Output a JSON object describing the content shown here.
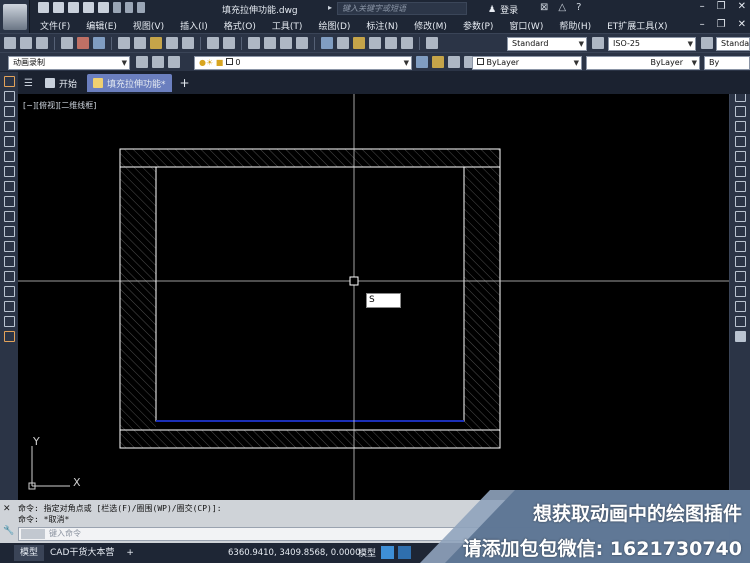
{
  "title_bar": {
    "doc_title": "填充拉伸功能.dwg",
    "search_placeholder": "键入关键字或短语",
    "login_label": "登录"
  },
  "menu": {
    "items": [
      "文件(F)",
      "编辑(E)",
      "视图(V)",
      "插入(I)",
      "格式(O)",
      "工具(T)",
      "绘图(D)",
      "标注(N)",
      "修改(M)",
      "参数(P)",
      "窗口(W)",
      "帮助(H)",
      "ET扩展工具(X)"
    ]
  },
  "toolbar": {
    "text_style": "Standard",
    "dim_style": "ISO-25",
    "table_style": "Standa",
    "workspace": "动画录制",
    "layer": "0",
    "color": "ByLayer",
    "linetype": "ByLayer",
    "lineweight": "By"
  },
  "tabs": {
    "start_label": "开始",
    "active_label": "填充拉伸功能*",
    "plus_label": "+"
  },
  "canvas": {
    "view_label": "[−][俯视][二维线框]",
    "dynamic_input": "S",
    "ucs_x": "X",
    "ucs_y": "Y",
    "background": "#000000",
    "frame_color": "#ffffff",
    "hatch_color": "#6e6e6e",
    "bottom_line_color": "#1b2fb8"
  },
  "command": {
    "history": [
      "命令: 指定对角点或 [栏选(F)/圈围(WP)/圈交(CP)]:",
      "命令: *取消*"
    ],
    "input_placeholder": "键入命令"
  },
  "status": {
    "model_tab": "模型",
    "layout_tab": "CAD干货大本营",
    "plus": "+",
    "coords": "6360.9410, 3409.8568, 0.0000",
    "mode": "模型"
  },
  "promo": {
    "line1": "想获取动画中的绘图插件",
    "line2": "请添加包包微信: 1621730740",
    "color": "#ffffff"
  }
}
